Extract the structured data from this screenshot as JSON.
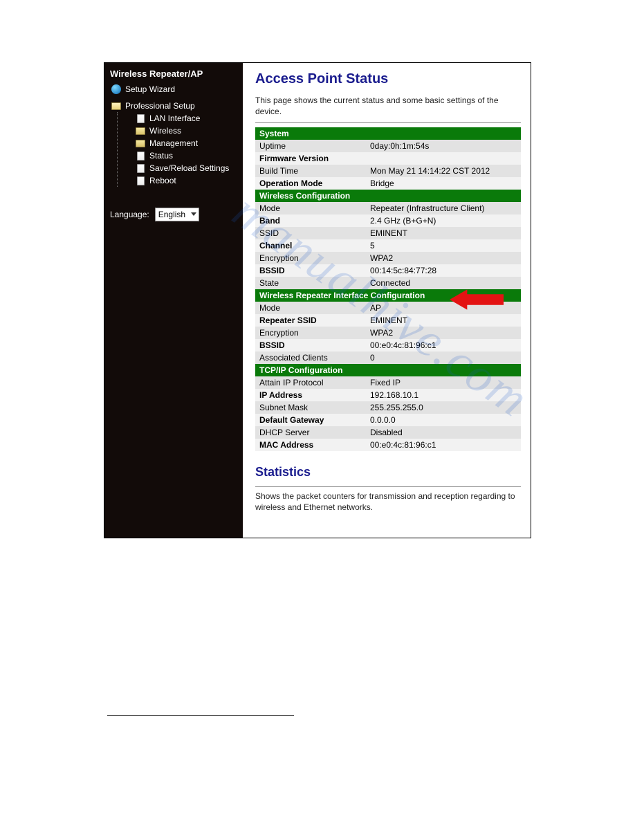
{
  "sidebar": {
    "title": "Wireless Repeater/AP",
    "wizard": "Setup Wizard",
    "pro_setup": "Professional Setup",
    "items": {
      "lan": "LAN Interface",
      "wireless": "Wireless",
      "management": "Management",
      "status": "Status",
      "save": "Save/Reload Settings",
      "reboot": "Reboot"
    }
  },
  "lang": {
    "label": "Language:",
    "value": "English"
  },
  "main": {
    "title": "Access Point Status",
    "desc": "This page shows the current status and some basic settings of the device.",
    "sections": {
      "system": {
        "header": "System",
        "rows": {
          "uptime_l": "Uptime",
          "uptime_v": "0day:0h:1m:54s",
          "fw_l": "Firmware Version",
          "fw_v": "",
          "build_l": "Build Time",
          "build_v": "Mon May 21 14:14:22 CST 2012",
          "op_l": "Operation Mode",
          "op_v": "Bridge"
        }
      },
      "wireless": {
        "header": "Wireless Configuration",
        "rows": {
          "mode_l": "Mode",
          "mode_v": "Repeater (Infrastructure Client)",
          "band_l": "Band",
          "band_v": "2.4 GHz (B+G+N)",
          "ssid_l": "SSID",
          "ssid_v": "EMINENT",
          "chan_l": "Channel",
          "chan_v": "5",
          "enc_l": "Encryption",
          "enc_v": "WPA2",
          "bssid_l": "BSSID",
          "bssid_v": "00:14:5c:84:77:28",
          "state_l": "State",
          "state_v": "Connected"
        }
      },
      "repeater": {
        "header": "Wireless Repeater Interface Configuration",
        "rows": {
          "mode_l": "Mode",
          "mode_v": "AP",
          "rssid_l": "Repeater SSID",
          "rssid_v": "EMINENT",
          "enc_l": "Encryption",
          "enc_v": "WPA2",
          "bssid_l": "BSSID",
          "bssid_v": "00:e0:4c:81:96:c1",
          "assoc_l": "Associated Clients",
          "assoc_v": "0"
        }
      },
      "tcpip": {
        "header": "TCP/IP Configuration",
        "rows": {
          "att_l": "Attain IP Protocol",
          "att_v": "Fixed IP",
          "ip_l": "IP Address",
          "ip_v": "192.168.10.1",
          "sub_l": "Subnet Mask",
          "sub_v": "255.255.255.0",
          "gw_l": "Default Gateway",
          "gw_v": "0.0.0.0",
          "dhcp_l": "DHCP Server",
          "dhcp_v": "Disabled",
          "mac_l": "MAC Address",
          "mac_v": "00:e0:4c:81:96:c1"
        }
      }
    },
    "stats_title": "Statistics",
    "stats_desc": "Shows the packet counters for transmission and reception regarding to wireless and Ethernet networks."
  },
  "watermark": "manualhive.com"
}
